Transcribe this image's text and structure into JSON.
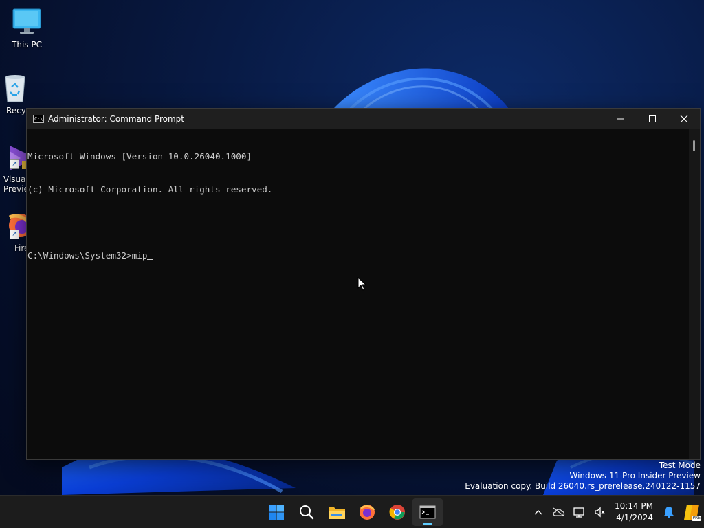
{
  "desktop": {
    "icons": [
      {
        "label": "This PC"
      },
      {
        "label": "Recycle Bin"
      },
      {
        "label": "Visual Studio 2022 Preview"
      },
      {
        "label": "Firefox"
      }
    ]
  },
  "window": {
    "title": "Administrator: Command Prompt",
    "app_icon_text": "C:\\",
    "lines": [
      "Microsoft Windows [Version 10.0.26040.1000]",
      "(c) Microsoft Corporation. All rights reserved."
    ],
    "prompt": "C:\\Windows\\System32>",
    "input": "mip"
  },
  "watermark": {
    "line1": "Test Mode",
    "line2": "Windows 11 Pro Insider Preview",
    "line3": "Evaluation copy. Build 26040.rs_prerelease.240122-1157"
  },
  "taskbar": {
    "apps": [
      "start-icon",
      "search-icon",
      "file-explorer-icon",
      "firefox-icon",
      "chrome-icon",
      "terminal-icon"
    ],
    "clock": {
      "time": "10:14 PM",
      "date": "4/1/2024"
    },
    "badge": "PRE"
  },
  "colors": {
    "accent": "#60cdff",
    "console_bg": "#0c0c0c",
    "console_fg": "#cccccc",
    "titlebar": "#1f1f1f",
    "taskbar": "#1c1c1c"
  }
}
